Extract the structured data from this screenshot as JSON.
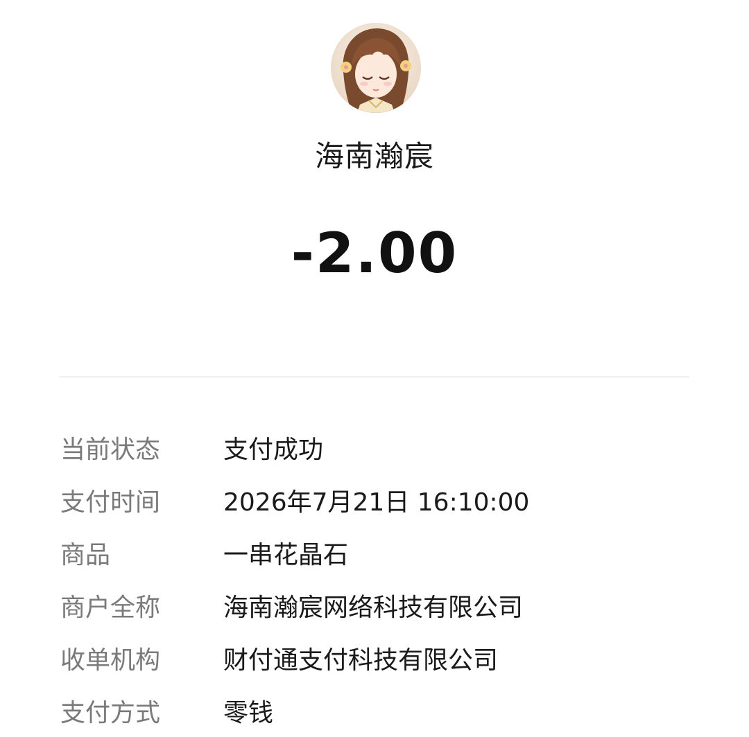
{
  "merchant": {
    "avatar_icon": "anime-girl-avatar",
    "name": "海南瀚宸"
  },
  "transaction": {
    "amount": "-2.00"
  },
  "details": [
    {
      "label": "当前状态",
      "value": "支付成功"
    },
    {
      "label": "支付时间",
      "value": "2026年7月21日 16:10:00"
    },
    {
      "label": "商品",
      "value": "一串花晶石"
    },
    {
      "label": "商户全称",
      "value": "海南瀚宸网络科技有限公司"
    },
    {
      "label": "收单机构",
      "value": "财付通支付科技有限公司"
    },
    {
      "label": "支付方式",
      "value": "零钱"
    }
  ]
}
